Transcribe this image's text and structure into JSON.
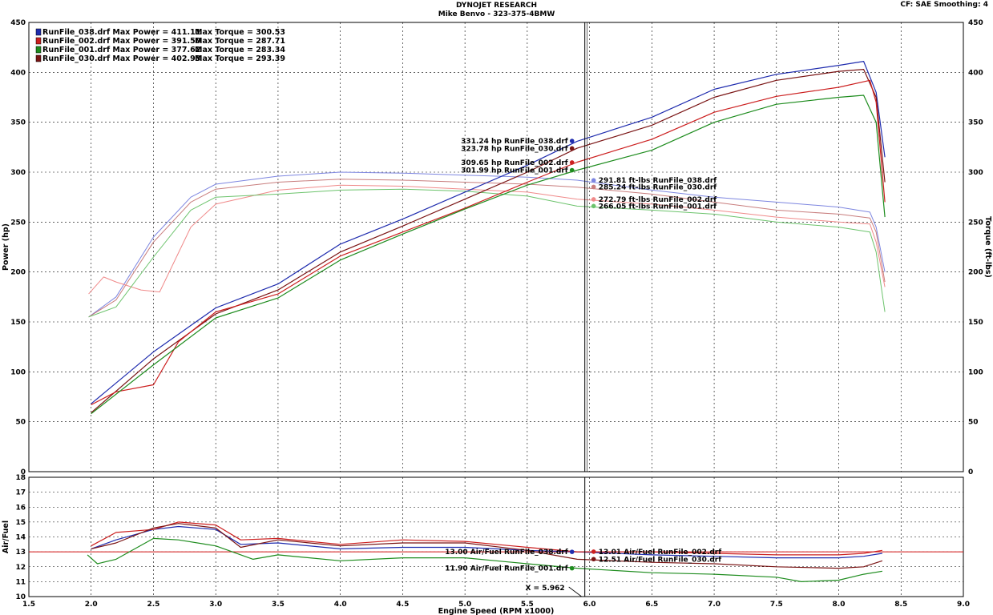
{
  "header": {
    "title": "DYNOJET RESEARCH",
    "subtitle": "Mike Benvo  - 323-375-4BMW",
    "settings": "CF: SAE  Smoothing: 4"
  },
  "colors": {
    "run_038": "#1f2cae",
    "run_002": "#cc1f1f",
    "run_001": "#1e8c1e",
    "run_030": "#7a1414",
    "run_038_light": "#7d86e0",
    "run_002_light": "#f08a8a",
    "run_001_light": "#6cc36c",
    "run_030_light": "#c87d7d",
    "reference_line": "#d01010",
    "grid": "#000000",
    "cursor": "#000000"
  },
  "chart_data": [
    {
      "type": "line",
      "name": "power-torque",
      "xlabel": "Engine Speed (RPM x1000)",
      "ylabel": "Power (hp)",
      "y2label": "Torque (ft-lbs)",
      "xlim": [
        1.5,
        9.0
      ],
      "ylim": [
        0,
        450
      ],
      "y2lim": [
        0,
        450
      ],
      "x_ticks": [
        "1.5",
        "2.0",
        "2.5",
        "3.0",
        "3.5",
        "4.0",
        "4.5",
        "5.0",
        "5.5",
        "6.0",
        "6.5",
        "7.0",
        "7.5",
        "8.0",
        "8.5",
        "9.0"
      ],
      "y_ticks": [
        "0",
        "50",
        "100",
        "150",
        "200",
        "250",
        "300",
        "350",
        "400",
        "450"
      ],
      "grid": true,
      "legend_position": "top-left",
      "legend": [
        {
          "run": "RunFile_038.drf",
          "power_label": "Max Power = 411.11",
          "torque_label": "Max Torque = 300.53",
          "color_key": "run_038"
        },
        {
          "run": "RunFile_002.drf",
          "power_label": "Max Power = 391.50",
          "torque_label": "Max Torque = 287.71",
          "color_key": "run_002"
        },
        {
          "run": "RunFile_001.drf",
          "power_label": "Max Power = 377.62",
          "torque_label": "Max Torque = 283.34",
          "color_key": "run_001"
        },
        {
          "run": "RunFile_030.drf",
          "power_label": "Max Power = 402.93",
          "torque_label": "Max Torque = 293.39",
          "color_key": "run_030"
        }
      ],
      "cursor_x": 5.962,
      "cursor_label": "X = 5.962",
      "power_series": [
        {
          "name": "RunFile_038.drf",
          "color_key": "run_038",
          "x": [
            2.0,
            2.5,
            3.0,
            3.5,
            4.0,
            4.5,
            5.0,
            5.5,
            5.9,
            6.5,
            7.0,
            7.5,
            8.0,
            8.2,
            8.3,
            8.37
          ],
          "y": [
            68,
            120,
            164,
            188,
            228,
            253,
            280,
            307,
            331,
            355,
            383,
            398,
            407,
            411,
            380,
            315
          ]
        },
        {
          "name": "RunFile_030.drf",
          "color_key": "run_030",
          "x": [
            2.0,
            2.5,
            3.0,
            3.5,
            4.0,
            4.5,
            5.0,
            5.5,
            5.9,
            6.5,
            7.0,
            7.5,
            8.0,
            8.2,
            8.3,
            8.37
          ],
          "y": [
            59,
            113,
            158,
            182,
            220,
            246,
            273,
            300,
            324,
            347,
            375,
            392,
            401,
            403,
            375,
            290
          ]
        },
        {
          "name": "RunFile_002.drf",
          "color_key": "run_002",
          "x": [
            2.0,
            2.2,
            2.5,
            2.7,
            3.0,
            3.5,
            4.0,
            4.5,
            5.0,
            5.5,
            5.9,
            6.5,
            7.0,
            7.5,
            8.0,
            8.25,
            8.3,
            8.37
          ],
          "y": [
            67,
            80,
            87,
            130,
            160,
            178,
            216,
            240,
            264,
            290,
            310,
            333,
            360,
            376,
            385,
            392,
            370,
            270
          ]
        },
        {
          "name": "RunFile_001.drf",
          "color_key": "run_001",
          "x": [
            2.0,
            2.5,
            3.0,
            3.5,
            4.0,
            4.5,
            5.0,
            5.5,
            5.9,
            6.5,
            7.0,
            7.5,
            8.0,
            8.2,
            8.3,
            8.37
          ],
          "y": [
            58,
            107,
            154,
            174,
            212,
            238,
            263,
            287,
            302,
            322,
            350,
            368,
            375,
            377,
            350,
            255
          ]
        }
      ],
      "torque_series": [
        {
          "name": "RunFile_038.drf",
          "color_key": "run_038_light",
          "x": [
            1.98,
            2.2,
            2.5,
            2.8,
            3.0,
            3.5,
            4.0,
            4.5,
            5.0,
            5.5,
            5.9,
            6.5,
            7.0,
            7.5,
            8.0,
            8.25,
            8.3,
            8.37
          ],
          "y": [
            155,
            175,
            235,
            275,
            288,
            296,
            300,
            299,
            297,
            295,
            292,
            282,
            275,
            270,
            265,
            260,
            245,
            200
          ]
        },
        {
          "name": "RunFile_030.drf",
          "color_key": "run_030_light",
          "x": [
            1.98,
            2.2,
            2.5,
            2.8,
            3.0,
            3.5,
            4.0,
            4.5,
            5.0,
            5.5,
            5.9,
            6.5,
            7.0,
            7.5,
            8.0,
            8.25,
            8.3,
            8.37
          ],
          "y": [
            155,
            172,
            230,
            270,
            283,
            290,
            293,
            292,
            290,
            288,
            285,
            278,
            270,
            262,
            258,
            254,
            240,
            190
          ]
        },
        {
          "name": "RunFile_002.drf",
          "color_key": "run_002_light",
          "x": [
            1.98,
            2.1,
            2.2,
            2.4,
            2.55,
            2.8,
            3.0,
            3.5,
            4.0,
            4.5,
            5.0,
            5.5,
            5.9,
            6.5,
            7.0,
            7.5,
            8.0,
            8.25,
            8.3,
            8.37
          ],
          "y": [
            178,
            195,
            190,
            182,
            180,
            245,
            268,
            282,
            287,
            286,
            283,
            280,
            273,
            268,
            262,
            255,
            250,
            248,
            230,
            185
          ]
        },
        {
          "name": "RunFile_001.drf",
          "color_key": "run_001_light",
          "x": [
            1.98,
            2.2,
            2.5,
            2.8,
            3.0,
            3.5,
            4.0,
            4.5,
            5.0,
            5.5,
            5.9,
            6.5,
            7.0,
            7.5,
            8.0,
            8.25,
            8.3,
            8.37
          ],
          "y": [
            155,
            165,
            215,
            262,
            275,
            278,
            282,
            283,
            281,
            276,
            266,
            262,
            258,
            250,
            245,
            240,
            220,
            160
          ]
        }
      ],
      "cursor_readouts": [
        {
          "text": "331.24 hp RunFile_038.drf",
          "y": 331.24,
          "color_key": "run_038",
          "side": "left"
        },
        {
          "text": "323.78 hp RunFile_030.drf",
          "y": 323.78,
          "color_key": "run_030",
          "side": "left"
        },
        {
          "text": "309.65 hp RunFile_002.drf",
          "y": 309.65,
          "color_key": "run_002",
          "side": "left"
        },
        {
          "text": "301.99 hp RunFile_001.drf",
          "y": 301.99,
          "color_key": "run_001",
          "side": "left"
        },
        {
          "text": "291.81 ft-lbs RunFile_038.drf",
          "y": 291.81,
          "color_key": "run_038_light",
          "side": "right"
        },
        {
          "text": "285.24 ft-lbs RunFile_030.drf",
          "y": 285.24,
          "color_key": "run_030_light",
          "side": "right"
        },
        {
          "text": "272.79 ft-lbs RunFile_002.drf",
          "y": 272.79,
          "color_key": "run_002_light",
          "side": "right"
        },
        {
          "text": "266.05 ft-lbs RunFile_001.drf",
          "y": 266.05,
          "color_key": "run_001_light",
          "side": "right"
        }
      ]
    },
    {
      "type": "line",
      "name": "air-fuel",
      "xlabel": "Engine Speed (RPM x1000)",
      "ylabel": "Air/Fuel",
      "xlim": [
        1.5,
        9.0
      ],
      "ylim": [
        10,
        18
      ],
      "x_ticks": [
        "1.5",
        "2.0",
        "2.5",
        "3.0",
        "3.5",
        "4.0",
        "4.5",
        "5.0",
        "5.5",
        "6.0",
        "6.5",
        "7.0",
        "7.5",
        "8.0",
        "8.5",
        "9.0"
      ],
      "y_ticks": [
        "10",
        "11",
        "12",
        "13",
        "14",
        "15",
        "16",
        "17",
        "18"
      ],
      "grid": true,
      "reference_value": 13,
      "series": [
        {
          "name": "RunFile_038.drf",
          "color_key": "run_038",
          "x": [
            2.0,
            2.2,
            2.5,
            2.7,
            3.0,
            3.2,
            3.5,
            4.0,
            4.5,
            5.0,
            5.5,
            5.9,
            6.5,
            7.0,
            7.5,
            8.0,
            8.2,
            8.35
          ],
          "y": [
            13.2,
            13.8,
            14.5,
            14.7,
            14.5,
            13.5,
            13.6,
            13.2,
            13.3,
            13.3,
            13.1,
            13.0,
            12.8,
            12.7,
            12.6,
            12.6,
            12.7,
            12.9
          ]
        },
        {
          "name": "RunFile_002.drf",
          "color_key": "run_002",
          "x": [
            2.0,
            2.2,
            2.5,
            2.7,
            3.0,
            3.2,
            3.5,
            4.0,
            4.5,
            5.0,
            5.5,
            5.9,
            6.5,
            7.0,
            7.5,
            8.0,
            8.2,
            8.35
          ],
          "y": [
            13.4,
            14.3,
            14.5,
            15.0,
            14.8,
            13.8,
            13.9,
            13.5,
            13.8,
            13.7,
            13.3,
            13.0,
            13.0,
            12.9,
            12.8,
            12.8,
            12.9,
            13.1
          ]
        },
        {
          "name": "RunFile_030.drf",
          "color_key": "run_030",
          "x": [
            2.0,
            2.2,
            2.5,
            2.7,
            3.0,
            3.2,
            3.5,
            4.0,
            4.5,
            5.0,
            5.5,
            5.9,
            6.5,
            7.0,
            7.5,
            8.0,
            8.2,
            8.35
          ],
          "y": [
            13.2,
            13.6,
            14.6,
            14.9,
            14.6,
            13.3,
            13.8,
            13.4,
            13.6,
            13.6,
            13.1,
            12.5,
            12.3,
            12.2,
            12.0,
            11.9,
            12.0,
            12.4
          ]
        },
        {
          "name": "RunFile_001.drf",
          "color_key": "run_001",
          "x": [
            1.97,
            2.05,
            2.2,
            2.5,
            2.7,
            3.0,
            3.3,
            3.5,
            4.0,
            4.5,
            5.0,
            5.5,
            5.9,
            6.5,
            7.0,
            7.5,
            7.7,
            8.0,
            8.2,
            8.35
          ],
          "y": [
            12.8,
            12.2,
            12.5,
            13.9,
            13.8,
            13.4,
            12.5,
            12.8,
            12.4,
            12.6,
            12.6,
            12.2,
            11.9,
            11.6,
            11.5,
            11.3,
            11.0,
            11.1,
            11.5,
            11.7
          ]
        }
      ],
      "cursor_readouts": [
        {
          "text": "13.00 Air/Fuel RunFile_038.drf",
          "y": 13.0,
          "color_key": "run_038",
          "side": "left"
        },
        {
          "text": "11.90 Air/Fuel RunFile_001.drf",
          "y": 11.9,
          "color_key": "run_001",
          "side": "left"
        },
        {
          "text": "13.01 Air/Fuel RunFile_002.drf",
          "y": 13.01,
          "color_key": "run_002",
          "side": "right"
        },
        {
          "text": "12.51 Air/Fuel RunFile_030.drf",
          "y": 12.51,
          "color_key": "run_030",
          "side": "right"
        }
      ]
    }
  ]
}
